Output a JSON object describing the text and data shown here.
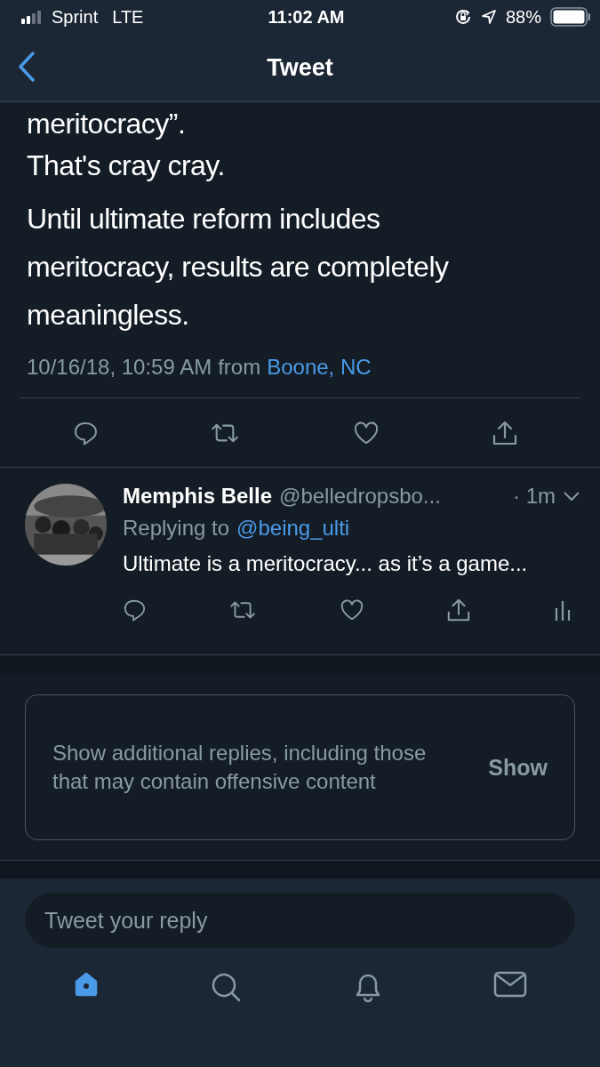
{
  "status_bar": {
    "carrier": "Sprint",
    "network": "LTE",
    "time": "11:02 AM",
    "battery": "88%"
  },
  "nav": {
    "title": "Tweet"
  },
  "tweet": {
    "cut_line": "meritocracy”.",
    "paragraphs": [
      "That's cray cray.",
      "Until ultimate reform includes meritocracy, results are completely meaningless."
    ],
    "timestamp": "10/16/18, 10:59 AM",
    "from": "from",
    "location": "Boone, NC"
  },
  "reply": {
    "name": "Memphis Belle",
    "handle": "@belledropsbo...",
    "time": "· 1m",
    "replying_to": "Replying to",
    "mention": "@being_ulti",
    "text": "Ultimate is a meritocracy... as it’s a game..."
  },
  "hidden_replies": {
    "text": "Show additional replies, including those that may contain offensive content",
    "button": "Show"
  },
  "compose": {
    "placeholder": "Tweet your reply"
  },
  "tabs": [
    {
      "kind": "home",
      "selected": true
    },
    {
      "kind": "search",
      "selected": false
    },
    {
      "kind": "notifications",
      "selected": false
    },
    {
      "kind": "messages",
      "selected": false
    }
  ]
}
